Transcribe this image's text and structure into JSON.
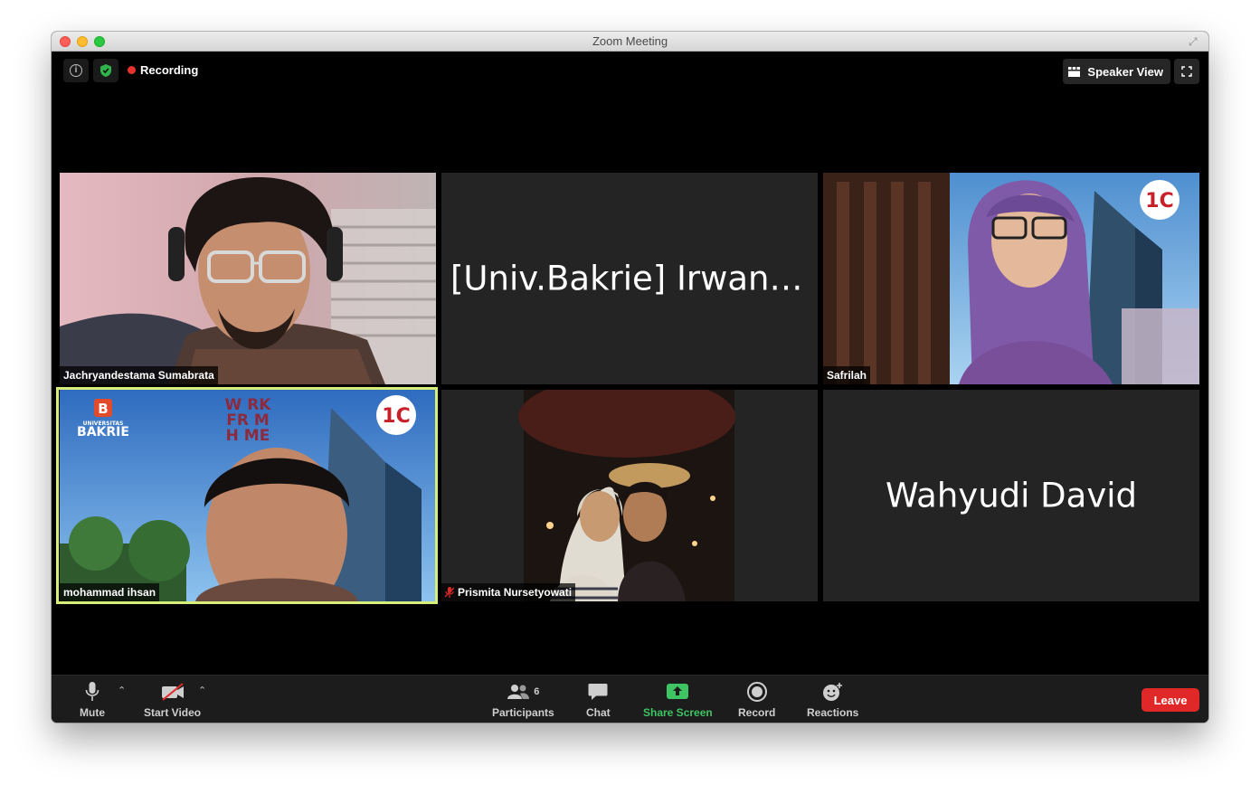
{
  "window": {
    "title": "Zoom Meeting"
  },
  "topbar": {
    "recording_label": "Recording",
    "speaker_view_label": "Speaker View"
  },
  "participants": [
    {
      "name": "Jachryandestama Sumabrata",
      "video": true
    },
    {
      "name": "[Univ.Bakrie] Irwan Pr…",
      "video": false
    },
    {
      "name": "Safrilah",
      "video": true
    },
    {
      "name": "mohammad ihsan",
      "video": true,
      "active_speaker": true,
      "background_text": {
        "brand": "UNIVERSITAS",
        "brand_name": "BAKRIE",
        "banner": [
          "W RK",
          "FR M",
          "H ME"
        ],
        "logo": "1C"
      }
    },
    {
      "name": "Prismita Nursetyowati",
      "video": true,
      "muted": true
    },
    {
      "name": "Wahyudi David",
      "video": false
    }
  ],
  "toolbar": {
    "mute_label": "Mute",
    "video_label": "Start Video",
    "participants_label": "Participants",
    "participants_count": "6",
    "chat_label": "Chat",
    "share_label": "Share Screen",
    "record_label": "Record",
    "reactions_label": "Reactions",
    "leave_label": "Leave"
  },
  "colors": {
    "recording": "#e8322c",
    "share": "#3ec463",
    "leave": "#e02828",
    "active_border": "#d8ee7a"
  }
}
